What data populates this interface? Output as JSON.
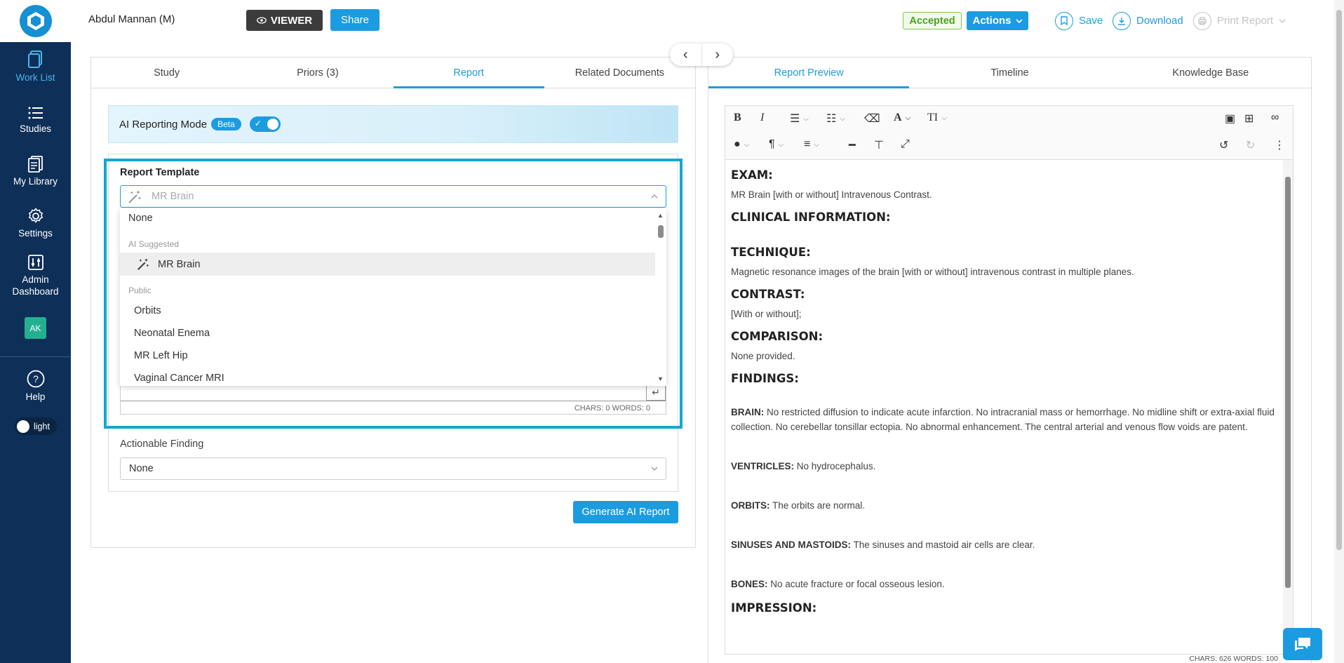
{
  "header": {
    "patient_name": "Abdul Mannan (M)",
    "viewer_label": "VIEWER",
    "share_label": "Share",
    "status_label": "Accepted",
    "actions_label": "Actions",
    "save_label": "Save",
    "download_label": "Download",
    "print_label": "Print Report"
  },
  "sidebar": {
    "items": [
      {
        "label": "Work List",
        "icon": "worklist-icon"
      },
      {
        "label": "Studies",
        "icon": "list-icon"
      },
      {
        "label": "My Library",
        "icon": "library-icon"
      },
      {
        "label": "Settings",
        "icon": "gear-icon"
      },
      {
        "label": "Admin Dashboard",
        "icon": "sliders-icon"
      }
    ],
    "avatar_initials": "AK",
    "help_label": "Help",
    "theme_label": "light"
  },
  "left_tabs": [
    "Study",
    "Priors (3)",
    "Report",
    "Related Documents"
  ],
  "right_tabs": [
    "Report Preview",
    "Timeline",
    "Knowledge Base"
  ],
  "ai_mode": {
    "label": "AI Reporting Mode",
    "beta": "Beta",
    "enabled": true
  },
  "report_template": {
    "title": "Report Template",
    "placeholder": "MR Brain",
    "options": {
      "none": "None",
      "group_ai": "AI Suggested",
      "ai_item": "MR Brain",
      "group_public": "Public",
      "public_items": [
        "Orbits",
        "Neonatal Enema",
        "MR Left Hip",
        "Vaginal Cancer MRI"
      ]
    },
    "counter": "CHARS: 0   WORDS: 0"
  },
  "actionable": {
    "label": "Actionable Finding",
    "value": "None"
  },
  "generate_label": "Generate AI Report",
  "report": {
    "exam_h": "EXAM:",
    "exam": "MR Brain [with or without] Intravenous Contrast.",
    "clinical_h": "CLINICAL INFORMATION:",
    "technique_h": "TECHNIQUE:",
    "technique": "Magnetic resonance images of the brain [with or without] intravenous contrast in multiple planes.",
    "contrast_h": "CONTRAST:",
    "contrast": "[With or without];",
    "comparison_h": "COMPARISON:",
    "comparison": "None provided.",
    "findings_h": "FINDINGS:",
    "brain_k": "BRAIN:",
    "brain": " No restricted diffusion to indicate acute infarction. No intracranial mass or hemorrhage. No midline shift or extra-axial fluid collection. No cerebellar tonsillar ectopia. No abnormal enhancement. The central arterial and venous flow voids are patent.",
    "ventricles_k": "VENTRICLES:",
    "ventricles": " No hydrocephalus.",
    "orbits_k": "ORBITS:",
    "orbits": " The orbits are normal.",
    "sinuses_k": "SINUSES AND MASTOIDS:",
    "sinuses": " The sinuses and mastoid air cells are clear.",
    "bones_k": "BONES:",
    "bones": " No acute fracture or focal osseous lesion.",
    "impression_h": "IMPRESSION:",
    "counter": "CHARS: 626   WORDS: 100"
  }
}
